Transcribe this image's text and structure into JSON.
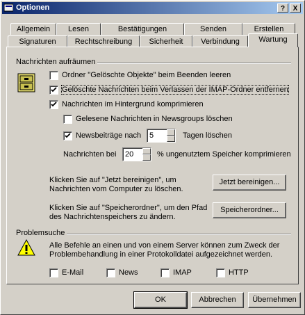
{
  "window": {
    "title": "Optionen",
    "help_btn": "?",
    "close_btn": "X"
  },
  "tabs_back": [
    "Allgemein",
    "Lesen",
    "Bestätigungen",
    "Senden",
    "Erstellen"
  ],
  "tabs_front": [
    "Signaturen",
    "Rechtschreibung",
    "Sicherheit",
    "Verbindung",
    "Wartung"
  ],
  "active_tab": "Wartung",
  "cleanup": {
    "title": "Nachrichten aufräumen",
    "opt_empty_deleted": "Ordner \"Gelöschte Objekte\" beim Beenden leeren",
    "opt_purge_imap": "Gelöschte Nachrichten beim Verlassen der IMAP-Ordner entfernen",
    "opt_compact_bg": "Nachrichten im Hintergrund komprimieren",
    "opt_delete_read_news": "Gelesene Nachrichten in Newsgroups löschen",
    "opt_delete_news_prefix": "Newsbeiträge nach",
    "days_value": "5",
    "opt_delete_news_suffix": "Tagen löschen",
    "compact_prefix": "Nachrichten bei",
    "compact_value": "20",
    "compact_suffix": "% ungenutztem Speicher komprimieren",
    "cleanup_text_1": "Klicken Sie auf \"Jetzt bereinigen\", um",
    "cleanup_text_2": "Nachrichten vom Computer zu löschen.",
    "cleanup_button": "Jetzt bereinigen...",
    "store_text_1": "Klicken Sie auf \"Speicherordner\", um den Pfad",
    "store_text_2": "des Nachrichtenspeichers zu ändern.",
    "store_button": "Speicherordner..."
  },
  "trouble": {
    "title": "Problemsuche",
    "text_1": "Alle Befehle an einen und von einem Server können zum Zweck der",
    "text_2": "Problembehandlung in einer Protokolldatei aufgezeichnet werden.",
    "log_email": "E-Mail",
    "log_news": "News",
    "log_imap": "IMAP",
    "log_http": "HTTP"
  },
  "footer": {
    "ok": "OK",
    "cancel": "Abbrechen",
    "apply": "Übernehmen"
  }
}
